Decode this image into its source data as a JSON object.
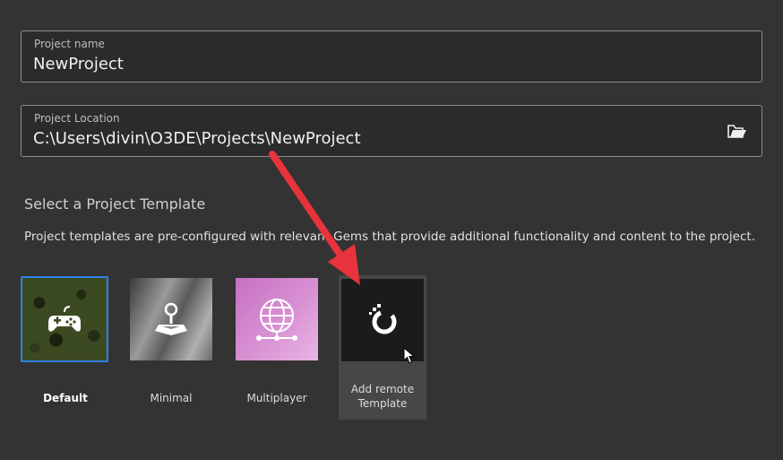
{
  "project_name": {
    "label": "Project name",
    "value": "NewProject"
  },
  "project_location": {
    "label": "Project Location",
    "value": "C:\\Users\\divin\\O3DE\\Projects\\NewProject",
    "browse_icon": "folder-open-icon"
  },
  "templates_section": {
    "title": "Select a Project Template",
    "description": "Project templates are pre-configured with relevant Gems that provide additional functionality and content to the project."
  },
  "templates": [
    {
      "label": "Default",
      "icon": "gamepad-icon",
      "selected": true
    },
    {
      "label": "Minimal",
      "icon": "joystick-icon",
      "selected": false
    },
    {
      "label": "Multiplayer",
      "icon": "globe-network-icon",
      "selected": false
    },
    {
      "label": "Add remote Template",
      "label_line1": "Add remote",
      "label_line2": "Template",
      "icon": "o3de-logo-icon",
      "selected": false
    }
  ],
  "colors": {
    "background": "#333333",
    "selected_border": "#2f7fe8",
    "annotation_arrow": "#e8323c"
  }
}
